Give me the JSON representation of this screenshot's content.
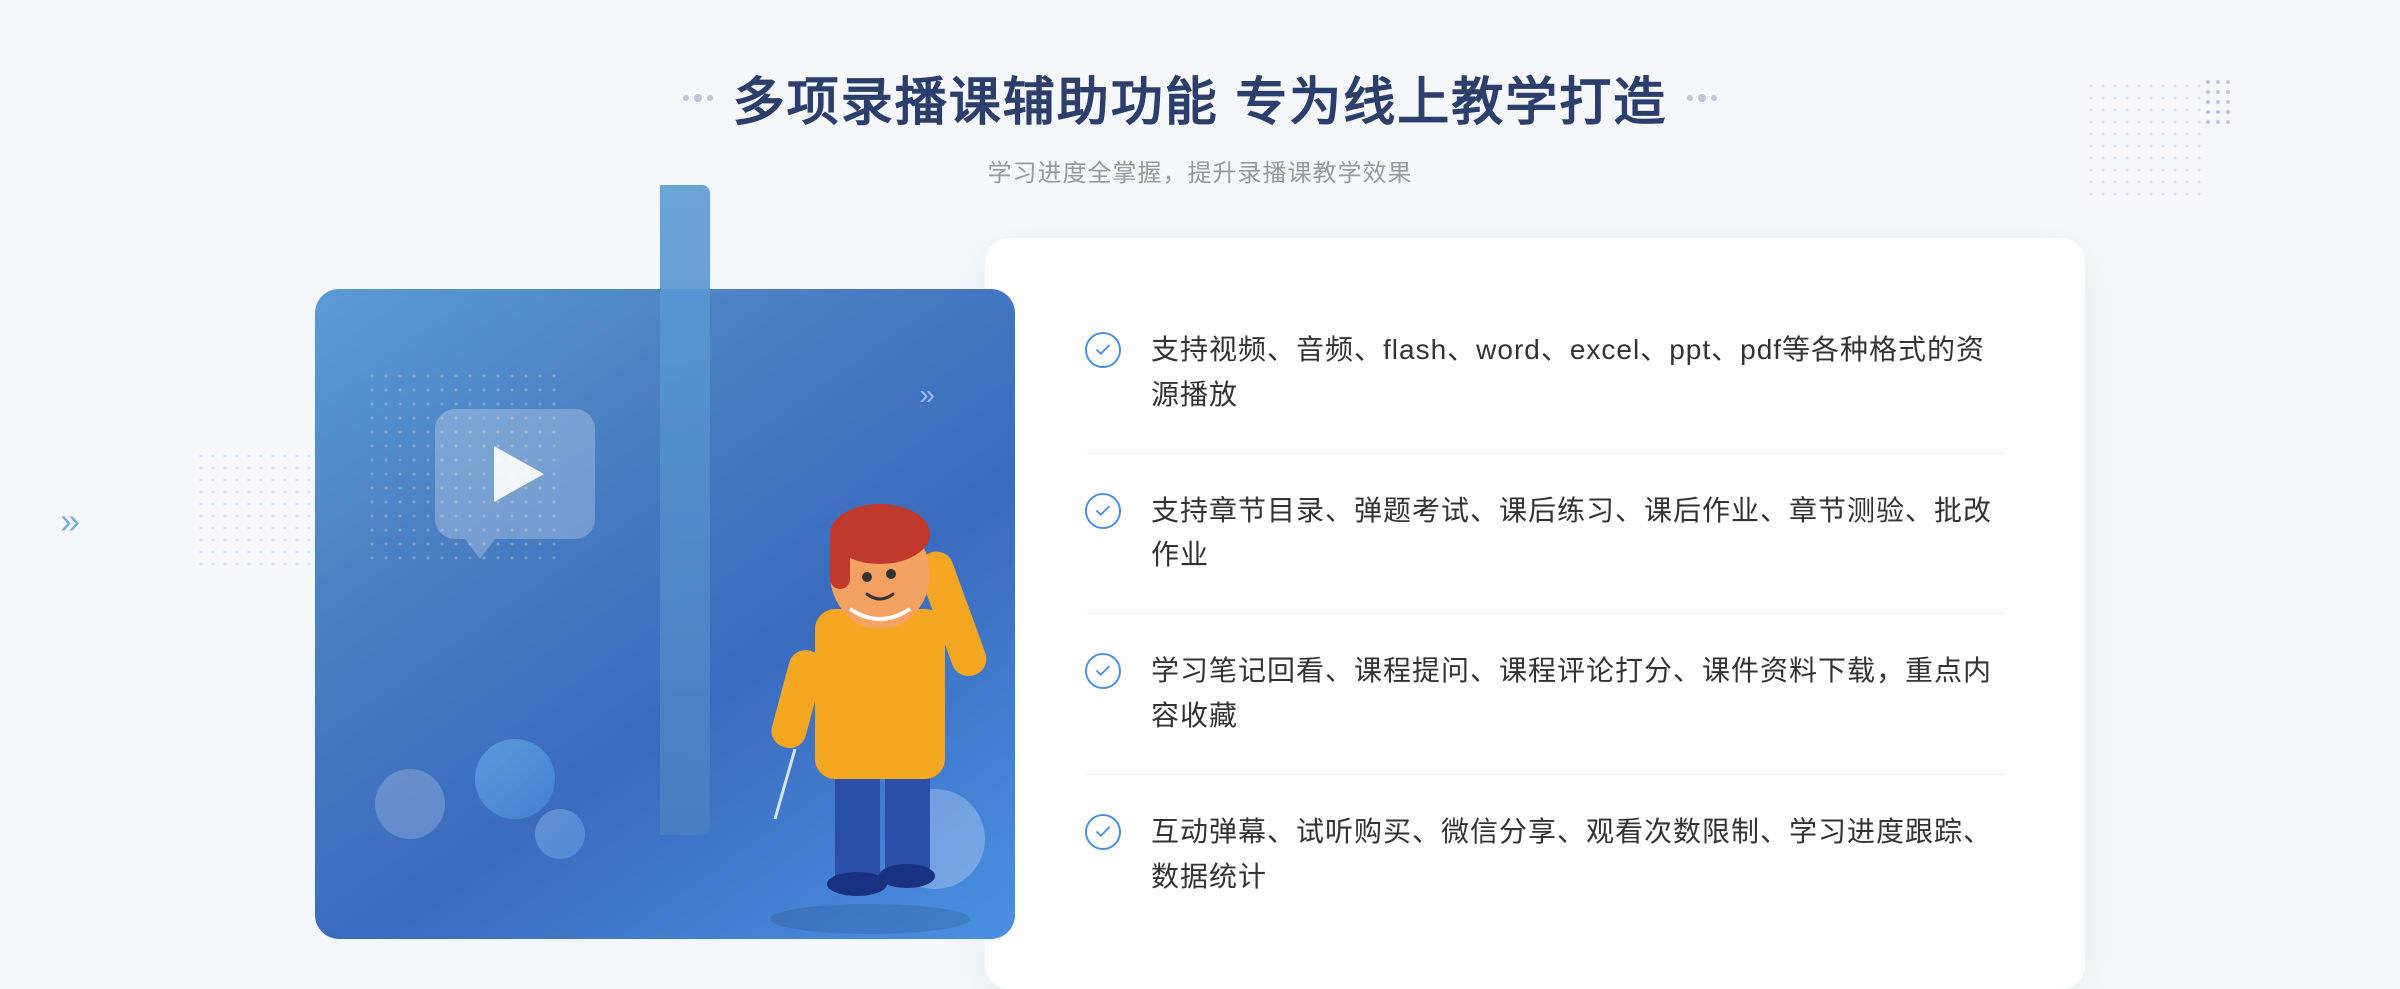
{
  "header": {
    "title": "多项录播课辅助功能 专为线上教学打造",
    "subtitle": "学习进度全掌握，提升录播课教学效果"
  },
  "features": [
    {
      "id": 1,
      "text": "支持视频、音频、flash、word、excel、ppt、pdf等各种格式的资源播放"
    },
    {
      "id": 2,
      "text": "支持章节目录、弹题考试、课后练习、课后作业、章节测验、批改作业"
    },
    {
      "id": 3,
      "text": "学习笔记回看、课程提问、课程评论打分、课件资料下载，重点内容收藏"
    },
    {
      "id": 4,
      "text": "互动弹幕、试听购买、微信分享、观看次数限制、学习进度跟踪、数据统计"
    }
  ],
  "decoration": {
    "arrow_left": "»",
    "arrow_card": "»"
  }
}
